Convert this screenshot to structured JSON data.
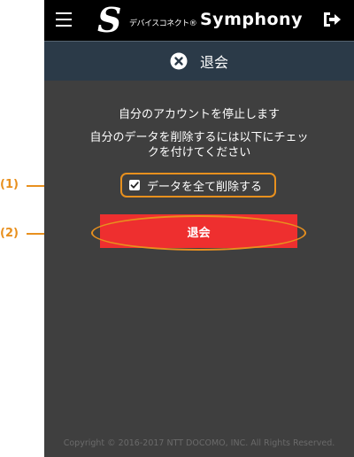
{
  "annotations": {
    "label1": "(1)",
    "label2": "(2)"
  },
  "header": {
    "logo_mark": "S",
    "logo_text_jp": "デバイスコネクト®",
    "logo_text_en": "Symphony",
    "menu_icon": "hamburger-menu-icon",
    "logout_icon": "logout-icon"
  },
  "subheader": {
    "icon": "close-circle-icon",
    "title": "退会"
  },
  "content": {
    "message_line1": "自分のアカウントを停止します",
    "message_line2": "自分のデータを削除するには以下にチェッ",
    "message_line3": "クを付けてください",
    "checkbox_label": "データを全て削除する",
    "checkbox_checked": true,
    "withdraw_button": "退会"
  },
  "footer": {
    "copyright": "Copyright © 2016-2017 NTT DOCOMO, INC. All Rights Reserved."
  },
  "colors": {
    "annotation": "#e8901e",
    "button": "#ee2f2f",
    "background": "#3f3f3f",
    "subbar": "#2b3a48"
  }
}
